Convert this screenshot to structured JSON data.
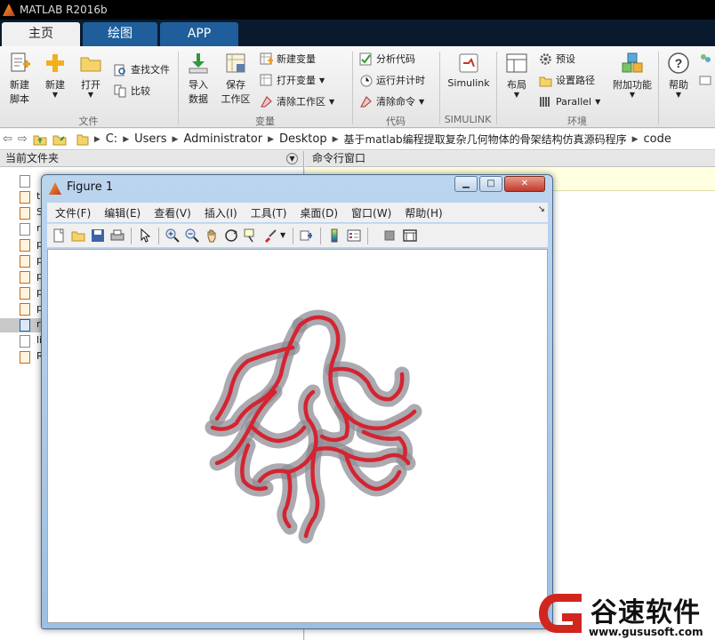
{
  "app": {
    "title": "MATLAB R2016b"
  },
  "tabs": [
    "主页",
    "绘图",
    "APP"
  ],
  "toolstrip": {
    "new_script": "新建\n脚本",
    "new": "新建",
    "open": "打开",
    "find_files": "查找文件",
    "compare": "比较",
    "import_data": "导入\n数据",
    "save_workspace": "保存\n工作区",
    "new_variable": "新建变量",
    "open_variable": "打开变量",
    "clear_workspace": "清除工作区",
    "analyze_code": "分析代码",
    "run_and_time": "运行并计时",
    "clear_commands": "清除命令",
    "simulink": "Simulink",
    "layout": "布局",
    "preferences": "预设",
    "set_path": "设置路径",
    "parallel": "Parallel",
    "addons": "附加功能",
    "help": "帮助",
    "groups": [
      "文件",
      "变量",
      "代码",
      "SIMULINK",
      "环境"
    ]
  },
  "path": {
    "segments": [
      "C:",
      "Users",
      "Administrator",
      "Desktop",
      "基于matlab编程提取复杂几何物体的骨架结构仿真源码程序",
      "code"
    ]
  },
  "left_panel": {
    "title": "当前文件夹",
    "files": [
      {
        "type": "other",
        "label": ""
      },
      {
        "type": "mlx",
        "label": "t"
      },
      {
        "type": "m",
        "label": "S"
      },
      {
        "type": "other",
        "label": "r"
      },
      {
        "type": "m",
        "label": "p"
      },
      {
        "type": "m",
        "label": "p"
      },
      {
        "type": "m",
        "label": "p"
      },
      {
        "type": "m",
        "label": "p"
      },
      {
        "type": "m",
        "label": "p"
      },
      {
        "type": "fig",
        "label": "r"
      },
      {
        "type": "other",
        "label": "li"
      },
      {
        "type": "m",
        "label": "R"
      }
    ]
  },
  "command_window": {
    "title": "命令行窗口"
  },
  "figure": {
    "title": "Figure 1",
    "menu": [
      "文件(F)",
      "编辑(E)",
      "查看(V)",
      "插入(I)",
      "工具(T)",
      "桌面(D)",
      "窗口(W)",
      "帮助(H)"
    ],
    "toolbar_icons": [
      "new-figure-icon",
      "open-file-icon",
      "save-icon",
      "print-icon",
      "select-arrow-icon",
      "zoom-in-icon",
      "zoom-out-icon",
      "pan-hand-icon",
      "rotate-3d-icon",
      "data-cursor-icon",
      "brush-icon",
      "link-plot-icon",
      "colorbar-icon",
      "legend-icon",
      "hide-plot-tools-icon",
      "show-plot-tools-icon"
    ],
    "colors": {
      "mesh": "#8e8e96",
      "skeleton": "#d42431"
    }
  },
  "watermark": {
    "text": "谷速软件",
    "url": "www.gususoft.com",
    "color": "#d0261d"
  }
}
